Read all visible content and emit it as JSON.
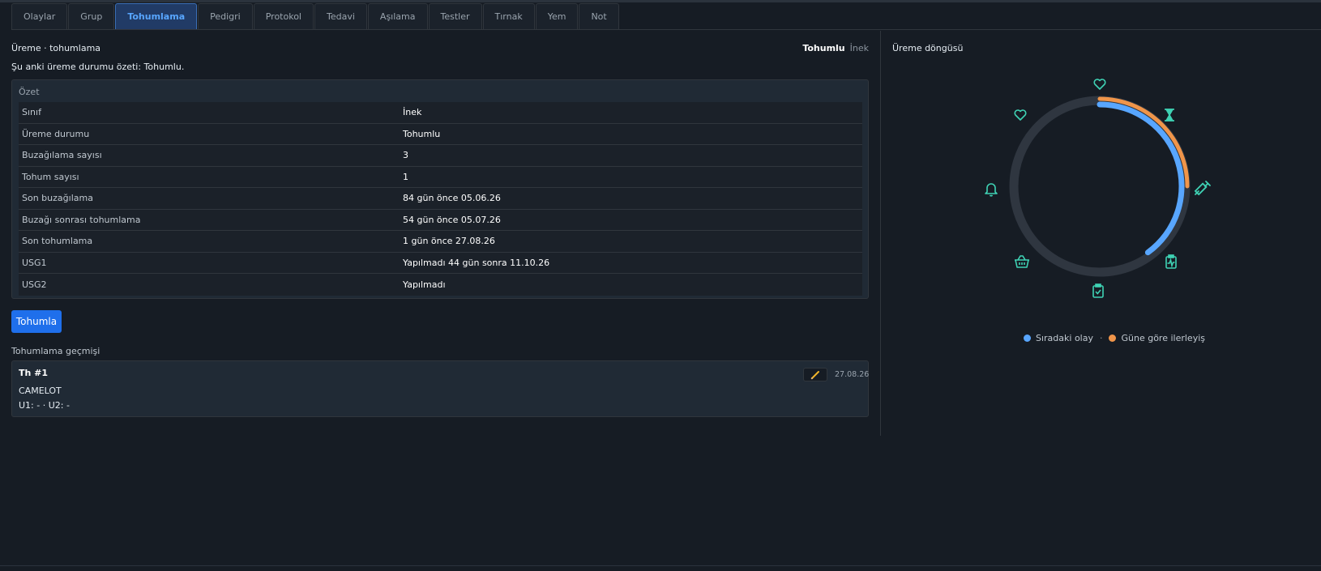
{
  "tabs": [
    "Olaylar",
    "Grup",
    "Tohumlama",
    "Pedigri",
    "Protokol",
    "Tedavi",
    "Aşılama",
    "Testler",
    "Tırnak",
    "Yem",
    "Not"
  ],
  "active_tab": "Tohumlama",
  "section": {
    "title": "Üreme · tohumlama",
    "status_badge": "Tohumlu",
    "class_badge": "İnek",
    "summary_text": "Şu anki üreme durumu özeti: Tohumlu."
  },
  "summary_card": {
    "title": "Özet",
    "rows": [
      {
        "key": "Sınıf",
        "value": "İnek"
      },
      {
        "key": "Üreme durumu",
        "value": "Tohumlu"
      },
      {
        "key": "Buzağılama sayısı",
        "value": "3"
      },
      {
        "key": "Tohum sayısı",
        "value": "1"
      },
      {
        "key": "Son buzağılama",
        "value": "84 gün önce 05.06.26"
      },
      {
        "key": "Buzağı sonrası tohumlama",
        "value": "54 gün önce 05.07.26"
      },
      {
        "key": "Son tohumlama",
        "value": "1 gün önce 27.08.26"
      },
      {
        "key": "USG1",
        "value": "Yapılmadı 44 gün sonra 11.10.26"
      },
      {
        "key": "USG2",
        "value": "Yapılmadı"
      }
    ]
  },
  "actions": {
    "inseminate_label": "Tohumla"
  },
  "history": {
    "label": "Tohumlama geçmişi",
    "entries": [
      {
        "title": "Th #1",
        "bull": "CAMELOT",
        "usg": "U1: - · U2: -",
        "date": "27.08.26",
        "edit_icon": "pencil-icon"
      }
    ]
  },
  "cycle": {
    "title": "Üreme döngüsü",
    "legend_next": "Sıradaki olay",
    "legend_sep": "·",
    "legend_progress": "Güne göre ilerleyiş",
    "next_event_fraction": 0.4,
    "day_progress_fraction": 0.25,
    "colors": {
      "track": "#2f3640",
      "next": "#58a6ff",
      "progress": "#f0954a",
      "icon": "#3fd2b4"
    },
    "icons": [
      "heart-icon",
      "hourglass-icon",
      "syringe-icon",
      "clipboard-pulse-icon",
      "clipboard-check-icon",
      "basket-icon",
      "bell-icon",
      "heart-outline-icon"
    ]
  }
}
